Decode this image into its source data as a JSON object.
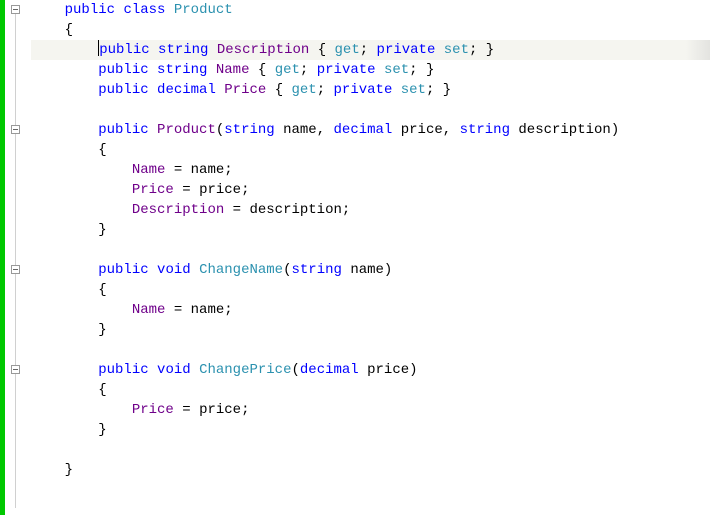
{
  "language": "csharp",
  "tokens": {
    "kw_public": "public",
    "kw_class": "class",
    "kw_string": "string",
    "kw_decimal": "decimal",
    "kw_void": "void",
    "kw_get": "get",
    "kw_set": "set",
    "kw_private": "private",
    "class_name": "Product",
    "prop_Description": "Description",
    "prop_Name": "Name",
    "prop_Price": "Price",
    "ctor_name": "Product",
    "method_ChangeName": "ChangeName",
    "method_ChangePrice": "ChangePrice",
    "param_name": "name",
    "param_price": "price",
    "param_description": "description",
    "brace_open": "{",
    "brace_close": "}",
    "paren_open": "(",
    "paren_close": ")",
    "semi": ";",
    "comma": ",",
    "equals": "=",
    "sp": " "
  },
  "indent": {
    "i1": "    ",
    "i2": "        ",
    "i3": "            ",
    "i4": "                "
  },
  "fold_regions": [
    {
      "line": 1,
      "collapsed": false
    },
    {
      "line": 7,
      "collapsed": false
    },
    {
      "line": 14,
      "collapsed": false
    },
    {
      "line": 19,
      "collapsed": false
    }
  ],
  "highlighted_line": 3,
  "cursor_line": 3,
  "cursor_col_before": "p"
}
